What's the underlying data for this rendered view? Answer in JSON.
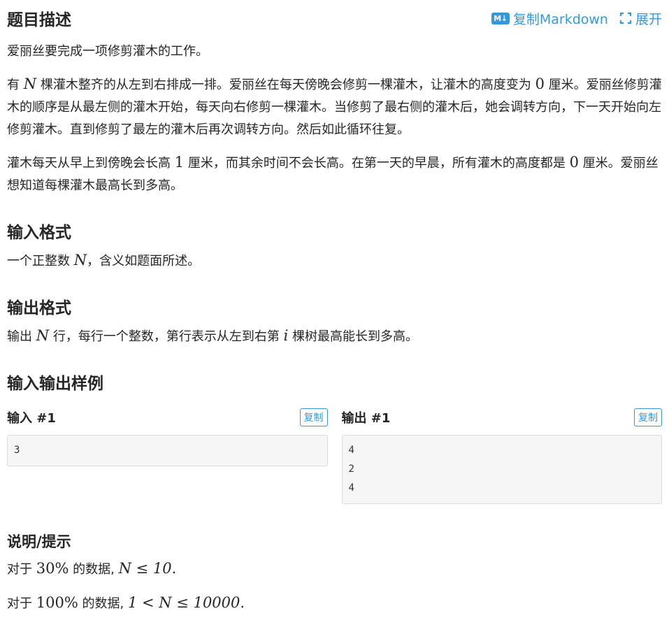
{
  "header": {
    "title": "题目描述",
    "copy_markdown_label": "复制Markdown",
    "copy_markdown_icon": "markdown-icon",
    "expand_label": "展开",
    "expand_icon": "expand-icon",
    "accent_color": "#3498db"
  },
  "description": {
    "p1": "爱丽丝要完成一项修剪灌木的工作。",
    "p2": [
      "有 ",
      "N",
      " 棵灌木整齐的从左到右排成一排。爱丽丝在每天傍晚会修剪一棵灌木，让灌木的高度变为 ",
      "0",
      " 厘米。爱丽丝修剪灌木的顺序是从最左侧的灌木开始，每天向右修剪一棵灌木。当修剪了最右侧的灌木后，她会调转方向，下一天开始向左修剪灌木。直到修剪了最左的灌木后再次调转方向。然后如此循环往复。"
    ],
    "p3": [
      "灌木每天从早上到傍晚会长高 ",
      "1",
      " 厘米，而其余时间不会长高。在第一天的早晨，所有灌木的高度都是 ",
      "0",
      " 厘米。爱丽丝想知道每棵灌木最高长到多高。"
    ]
  },
  "input_format": {
    "title": "输入格式",
    "text": [
      "一个正整数 ",
      "N",
      "，含义如题面所述。"
    ]
  },
  "output_format": {
    "title": "输出格式",
    "text": [
      "输出 ",
      "N",
      " 行，每行一个整数，第行表示从左到右第 ",
      "i",
      " 棵树最高能长到多高。"
    ]
  },
  "samples": {
    "title": "输入输出样例",
    "input_title": "输入 #1",
    "output_title": "输出 #1",
    "copy_label": "复制",
    "input_lines": [
      "3"
    ],
    "output_lines": [
      "4",
      "2",
      "4"
    ]
  },
  "hint": {
    "title": "说明/提示",
    "line1": [
      "对于 ",
      "30%",
      " 的数据, ",
      "N ≤ 10",
      "."
    ],
    "line2": [
      "对于 ",
      "100%",
      " 的数据, ",
      "1 < N ≤ 10000",
      "."
    ]
  }
}
